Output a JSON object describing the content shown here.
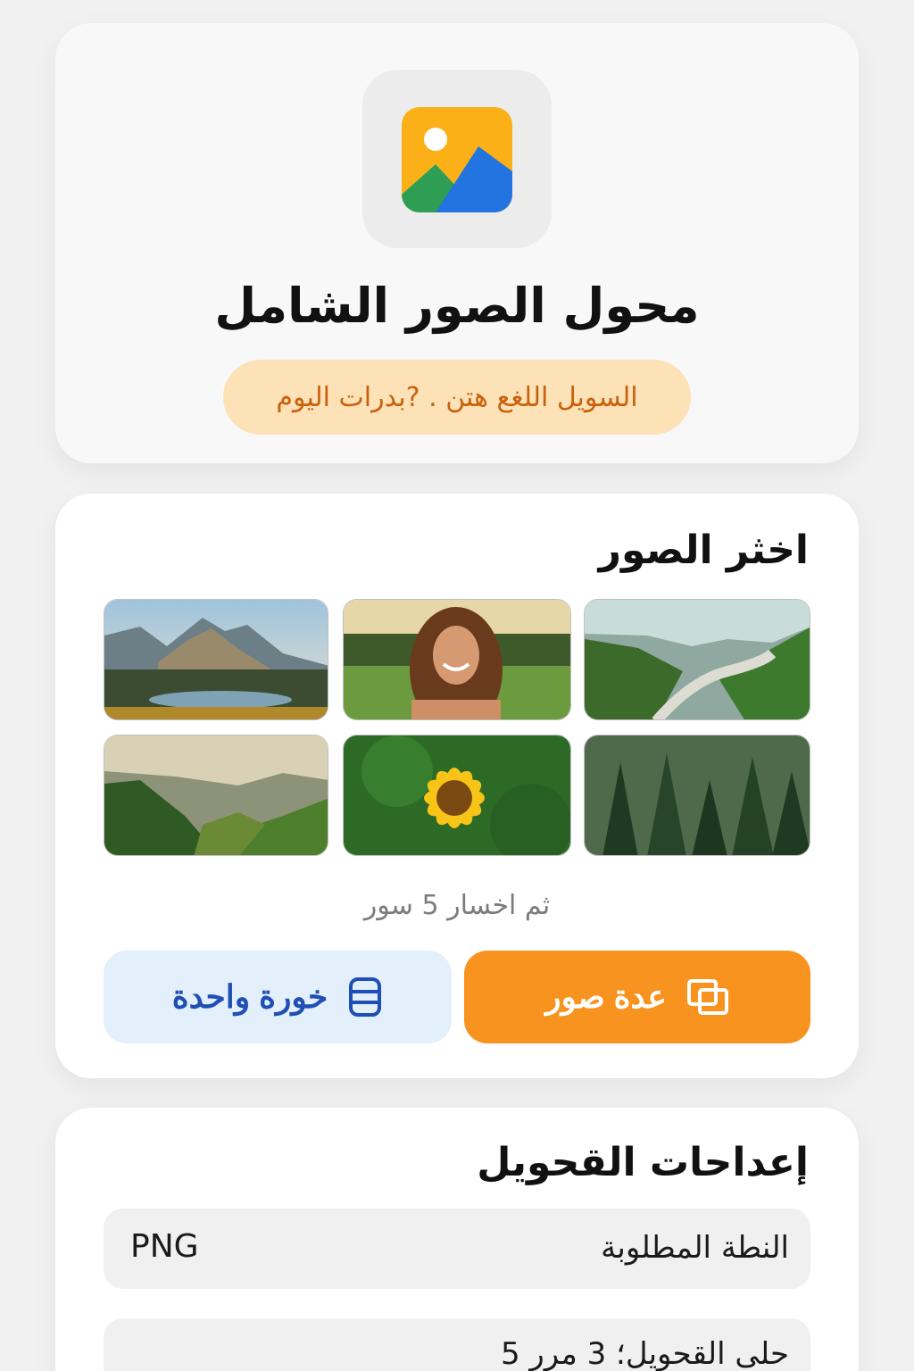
{
  "header": {
    "app_icon": "image-gallery-icon",
    "title": "محول الصور الشامل",
    "promo_text": "السويل اللغع هتن . ?بدرات اليوم"
  },
  "image_picker": {
    "title": "اخثر الصور",
    "thumbnails": [
      {
        "name": "mountain-lake-photo"
      },
      {
        "name": "smiling-woman-photo"
      },
      {
        "name": "valley-road-photo"
      },
      {
        "name": "misty-hills-photo"
      },
      {
        "name": "sunflower-photo"
      },
      {
        "name": "pine-forest-photo"
      }
    ],
    "selected_count_text": "ثم اخسار 5 سور",
    "single_button": {
      "label": "خورة واحدة",
      "icon": "single-image-icon"
    },
    "multi_button": {
      "label": "عدة صور",
      "icon": "multiple-images-icon"
    }
  },
  "settings": {
    "title": "إعداحات القحويل",
    "format_label": "النطة المطلوبة",
    "format_value": "PNG",
    "progress_label": "حلى القحويل؛ 3 مرر 5"
  },
  "colors": {
    "accent_orange": "#f7931e",
    "single_button_bg": "#e4effc",
    "single_button_text": "#1f4fb4",
    "promo_bg": "#fde2b8",
    "promo_text": "#c9610b"
  }
}
